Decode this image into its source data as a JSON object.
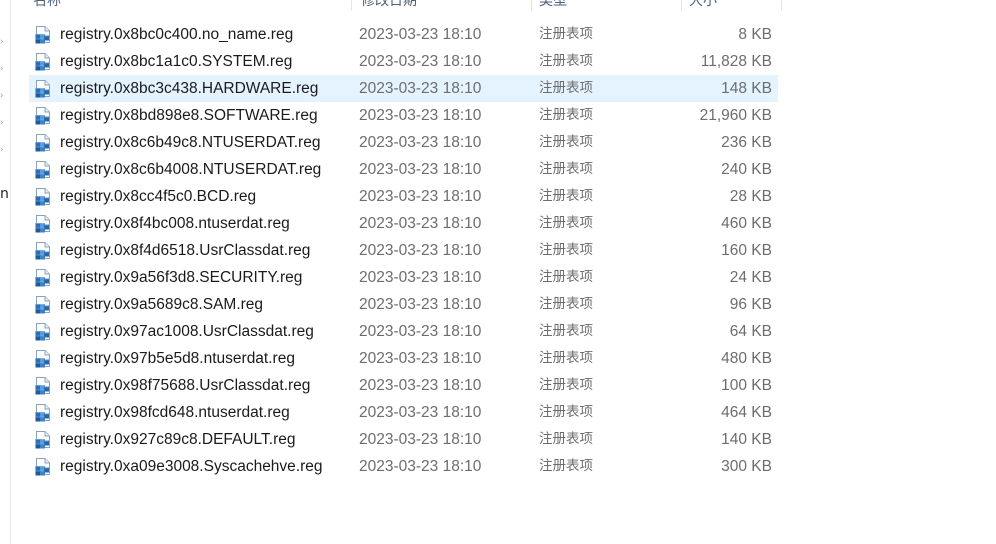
{
  "header": {
    "columns": [
      {
        "label": "名称"
      },
      {
        "label": "修改日期"
      },
      {
        "label": "类型"
      },
      {
        "label": "大小"
      }
    ]
  },
  "nav": {
    "partial_label": "n"
  },
  "icon_name": "registry-file-icon",
  "selected_index": 2,
  "files": [
    {
      "name": "registry.0x8bc0c400.no_name.reg",
      "date": "2023-03-23 18:10",
      "type": "注册表项",
      "size": "8 KB"
    },
    {
      "name": "registry.0x8bc1a1c0.SYSTEM.reg",
      "date": "2023-03-23 18:10",
      "type": "注册表项",
      "size": "11,828 KB"
    },
    {
      "name": "registry.0x8bc3c438.HARDWARE.reg",
      "date": "2023-03-23 18:10",
      "type": "注册表项",
      "size": "148 KB"
    },
    {
      "name": "registry.0x8bd898e8.SOFTWARE.reg",
      "date": "2023-03-23 18:10",
      "type": "注册表项",
      "size": "21,960 KB"
    },
    {
      "name": "registry.0x8c6b49c8.NTUSERDAT.reg",
      "date": "2023-03-23 18:10",
      "type": "注册表项",
      "size": "236 KB"
    },
    {
      "name": "registry.0x8c6b4008.NTUSERDAT.reg",
      "date": "2023-03-23 18:10",
      "type": "注册表项",
      "size": "240 KB"
    },
    {
      "name": "registry.0x8cc4f5c0.BCD.reg",
      "date": "2023-03-23 18:10",
      "type": "注册表项",
      "size": "28 KB"
    },
    {
      "name": "registry.0x8f4bc008.ntuserdat.reg",
      "date": "2023-03-23 18:10",
      "type": "注册表项",
      "size": "460 KB"
    },
    {
      "name": "registry.0x8f4d6518.UsrClassdat.reg",
      "date": "2023-03-23 18:10",
      "type": "注册表项",
      "size": "160 KB"
    },
    {
      "name": "registry.0x9a56f3d8.SECURITY.reg",
      "date": "2023-03-23 18:10",
      "type": "注册表项",
      "size": "24 KB"
    },
    {
      "name": "registry.0x9a5689c8.SAM.reg",
      "date": "2023-03-23 18:10",
      "type": "注册表项",
      "size": "96 KB"
    },
    {
      "name": "registry.0x97ac1008.UsrClassdat.reg",
      "date": "2023-03-23 18:10",
      "type": "注册表项",
      "size": "64 KB"
    },
    {
      "name": "registry.0x97b5e5d8.ntuserdat.reg",
      "date": "2023-03-23 18:10",
      "type": "注册表项",
      "size": "480 KB"
    },
    {
      "name": "registry.0x98f75688.UsrClassdat.reg",
      "date": "2023-03-23 18:10",
      "type": "注册表项",
      "size": "100 KB"
    },
    {
      "name": "registry.0x98fcd648.ntuserdat.reg",
      "date": "2023-03-23 18:10",
      "type": "注册表项",
      "size": "464 KB"
    },
    {
      "name": "registry.0x927c89c8.DEFAULT.reg",
      "date": "2023-03-23 18:10",
      "type": "注册表项",
      "size": "140 KB"
    },
    {
      "name": "registry.0xa09e3008.Syscachehve.reg",
      "date": "2023-03-23 18:10",
      "type": "注册表项",
      "size": "300 KB"
    }
  ]
}
